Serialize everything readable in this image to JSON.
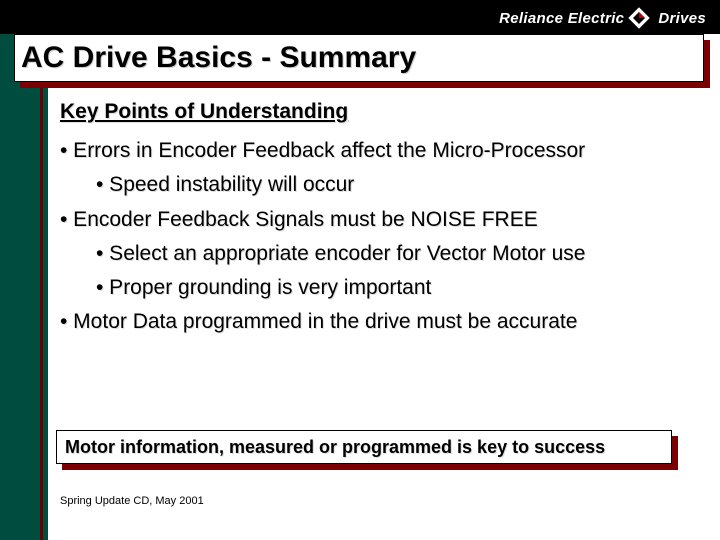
{
  "brand": {
    "prefix": "Reliance Electric",
    "suffix": "Drives"
  },
  "title": "AC Drive Basics - Summary",
  "subhead": "Key Points of Understanding",
  "bullets": {
    "b1": "• Errors in Encoder Feedback affect the Micro-Processor",
    "b1a": "• Speed instability will occur",
    "b2": "• Encoder Feedback Signals must be NOISE FREE",
    "b2a": "• Select an appropriate encoder for Vector Motor use",
    "b2b": "• Proper grounding is very important",
    "b3": "• Motor Data programmed in the drive must be accurate"
  },
  "callout": "Motor information, measured or programmed is key to success",
  "footer": "Spring Update CD, May 2001"
}
